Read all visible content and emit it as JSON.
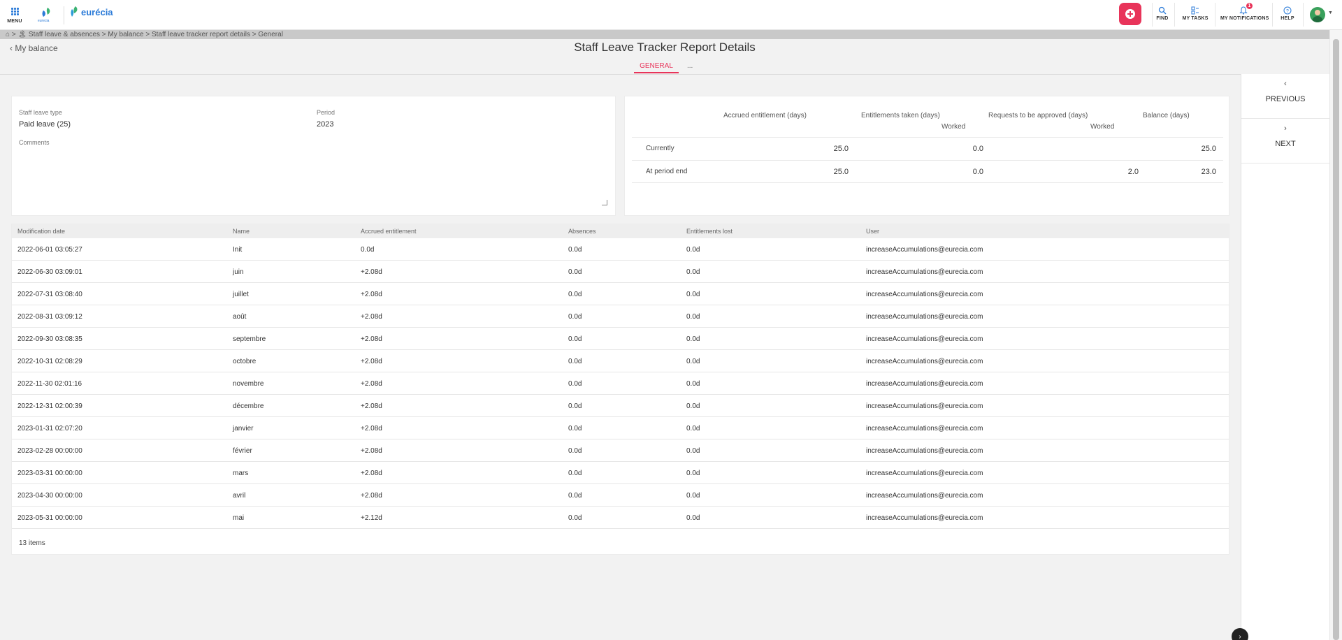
{
  "topbar": {
    "menu_label": "MENU",
    "logo_small_text": "eurecia",
    "brand_name": "eurécia",
    "find_label": "FIND",
    "tasks_label": "MY TASKS",
    "notifications_label": "MY NOTIFICATIONS",
    "notifications_count": "1",
    "help_label": "HELP",
    "accent_color": "#e8345a",
    "brand_color": "#2b7bd8"
  },
  "breadcrumb": {
    "text": "⌂ > 🏝 Staff leave & absences > My balance > Staff leave tracker report details > General"
  },
  "header": {
    "back_label": "My balance",
    "title": "Staff Leave Tracker Report Details",
    "tab_general": "GENERAL",
    "tab_more": "..."
  },
  "rightnav": {
    "previous_label": "PREVIOUS",
    "next_label": "NEXT"
  },
  "details": {
    "leave_type_label": "Staff leave type",
    "leave_type_value": "Paid leave (25)",
    "period_label": "Period",
    "period_value": "2023",
    "comments_label": "Comments",
    "comments_value": ""
  },
  "balance": {
    "headers": {
      "accrued": "Accrued entitlement (days)",
      "taken": "Entitlements taken (days)",
      "requests": "Requests to be approved (days)",
      "balance": "Balance (days)",
      "taken_sub": "Worked",
      "requests_sub": "Worked"
    },
    "rows": [
      {
        "label": "Currently",
        "accrued": "25.0",
        "taken": "0.0",
        "requests": "",
        "balance": "25.0"
      },
      {
        "label": "At period end",
        "accrued": "25.0",
        "taken": "0.0",
        "requests": "2.0",
        "balance": "23.0"
      }
    ]
  },
  "table": {
    "columns": [
      "Modification date",
      "Name",
      "Accrued entitlement",
      "Absences",
      "Entitlements lost",
      "User"
    ],
    "rows": [
      [
        "2022-06-01 03:05:27",
        "Init",
        "0.0d",
        "0.0d",
        "0.0d",
        "increaseAccumulations@eurecia.com"
      ],
      [
        "2022-06-30 03:09:01",
        "juin",
        "+2.08d",
        "0.0d",
        "0.0d",
        "increaseAccumulations@eurecia.com"
      ],
      [
        "2022-07-31 03:08:40",
        "juillet",
        "+2.08d",
        "0.0d",
        "0.0d",
        "increaseAccumulations@eurecia.com"
      ],
      [
        "2022-08-31 03:09:12",
        "août",
        "+2.08d",
        "0.0d",
        "0.0d",
        "increaseAccumulations@eurecia.com"
      ],
      [
        "2022-09-30 03:08:35",
        "septembre",
        "+2.08d",
        "0.0d",
        "0.0d",
        "increaseAccumulations@eurecia.com"
      ],
      [
        "2022-10-31 02:08:29",
        "octobre",
        "+2.08d",
        "0.0d",
        "0.0d",
        "increaseAccumulations@eurecia.com"
      ],
      [
        "2022-11-30 02:01:16",
        "novembre",
        "+2.08d",
        "0.0d",
        "0.0d",
        "increaseAccumulations@eurecia.com"
      ],
      [
        "2022-12-31 02:00:39",
        "décembre",
        "+2.08d",
        "0.0d",
        "0.0d",
        "increaseAccumulations@eurecia.com"
      ],
      [
        "2023-01-31 02:07:20",
        "janvier",
        "+2.08d",
        "0.0d",
        "0.0d",
        "increaseAccumulations@eurecia.com"
      ],
      [
        "2023-02-28 00:00:00",
        "février",
        "+2.08d",
        "0.0d",
        "0.0d",
        "increaseAccumulations@eurecia.com"
      ],
      [
        "2023-03-31 00:00:00",
        "mars",
        "+2.08d",
        "0.0d",
        "0.0d",
        "increaseAccumulations@eurecia.com"
      ],
      [
        "2023-04-30 00:00:00",
        "avril",
        "+2.08d",
        "0.0d",
        "0.0d",
        "increaseAccumulations@eurecia.com"
      ],
      [
        "2023-05-31 00:00:00",
        "mai",
        "+2.12d",
        "0.0d",
        "0.0d",
        "increaseAccumulations@eurecia.com"
      ]
    ],
    "item_count": "13 items"
  },
  "float_button_icon": "chevron-right-icon"
}
